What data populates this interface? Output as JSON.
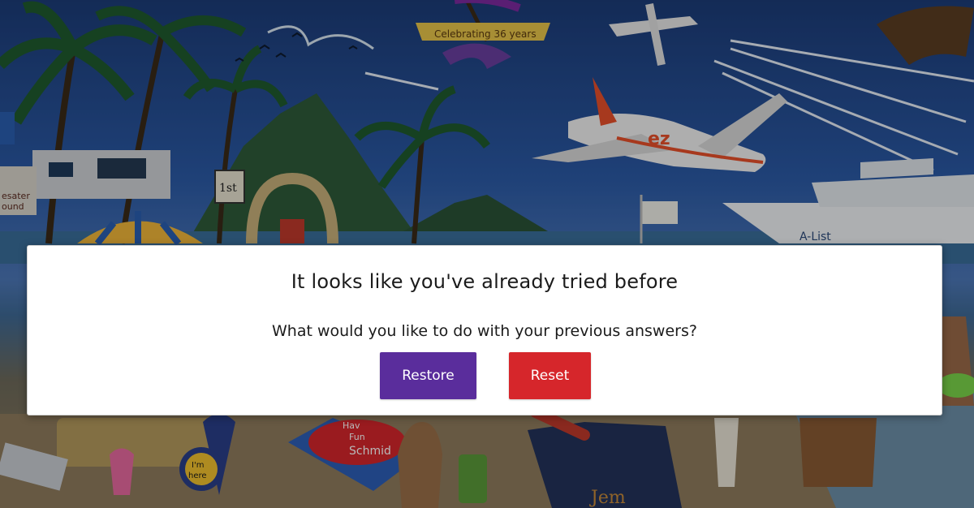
{
  "background": {
    "banner_text": "Celebrating 36 years",
    "plane_logo": "ez",
    "sign_first": "1st",
    "pin_text_line1": "I'm",
    "pin_text_line2": "here",
    "towel_text_line1": "Hav",
    "towel_text_line2": "Fun",
    "towel_text_line3": "Schmid",
    "ship_text": "A-List",
    "left_sign_line1": "esater",
    "left_sign_line2": "ound",
    "apron_text": "Jem",
    "colors": {
      "sky_top": "#1c3c78",
      "sky_mid": "#2b5aa6",
      "sand": "#8f7c5e",
      "palm_green": "#1f5a2e",
      "overlay": "rgba(0,0,0,0.28)"
    }
  },
  "dialog": {
    "title": "It looks like you've already tried before",
    "subtitle": "What would you like to do with your previous answers?",
    "restore_label": "Restore",
    "reset_label": "Reset",
    "colors": {
      "restore": "#5a2d9c",
      "reset": "#d6262b"
    }
  }
}
